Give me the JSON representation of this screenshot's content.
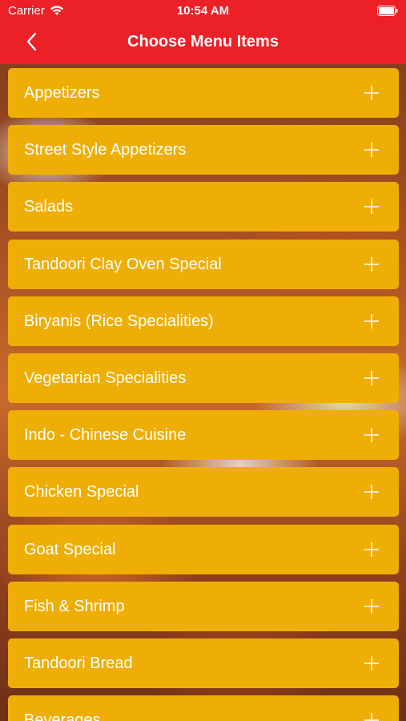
{
  "status_bar": {
    "carrier": "Carrier",
    "time": "10:54 AM",
    "icons": [
      "wifi-icon",
      "battery-icon"
    ]
  },
  "nav_bar": {
    "title": "Choose Menu Items",
    "back_icon": "chevron-left-icon",
    "background_color": "#ec2027"
  },
  "menu": {
    "item_color": "#efae05",
    "expand_icon": "plus-icon",
    "items": [
      {
        "label": "Appetizers"
      },
      {
        "label": "Street Style Appetizers"
      },
      {
        "label": "Salads"
      },
      {
        "label": "Tandoori Clay Oven Special"
      },
      {
        "label": "Biryanis (Rice Specialities)"
      },
      {
        "label": "Vegetarian Specialities"
      },
      {
        "label": "Indo - Chinese Cuisine"
      },
      {
        "label": "Chicken Special"
      },
      {
        "label": "Goat Special"
      },
      {
        "label": "Fish & Shrimp"
      },
      {
        "label": "Tandoori Bread"
      },
      {
        "label": "Beverages"
      }
    ]
  }
}
